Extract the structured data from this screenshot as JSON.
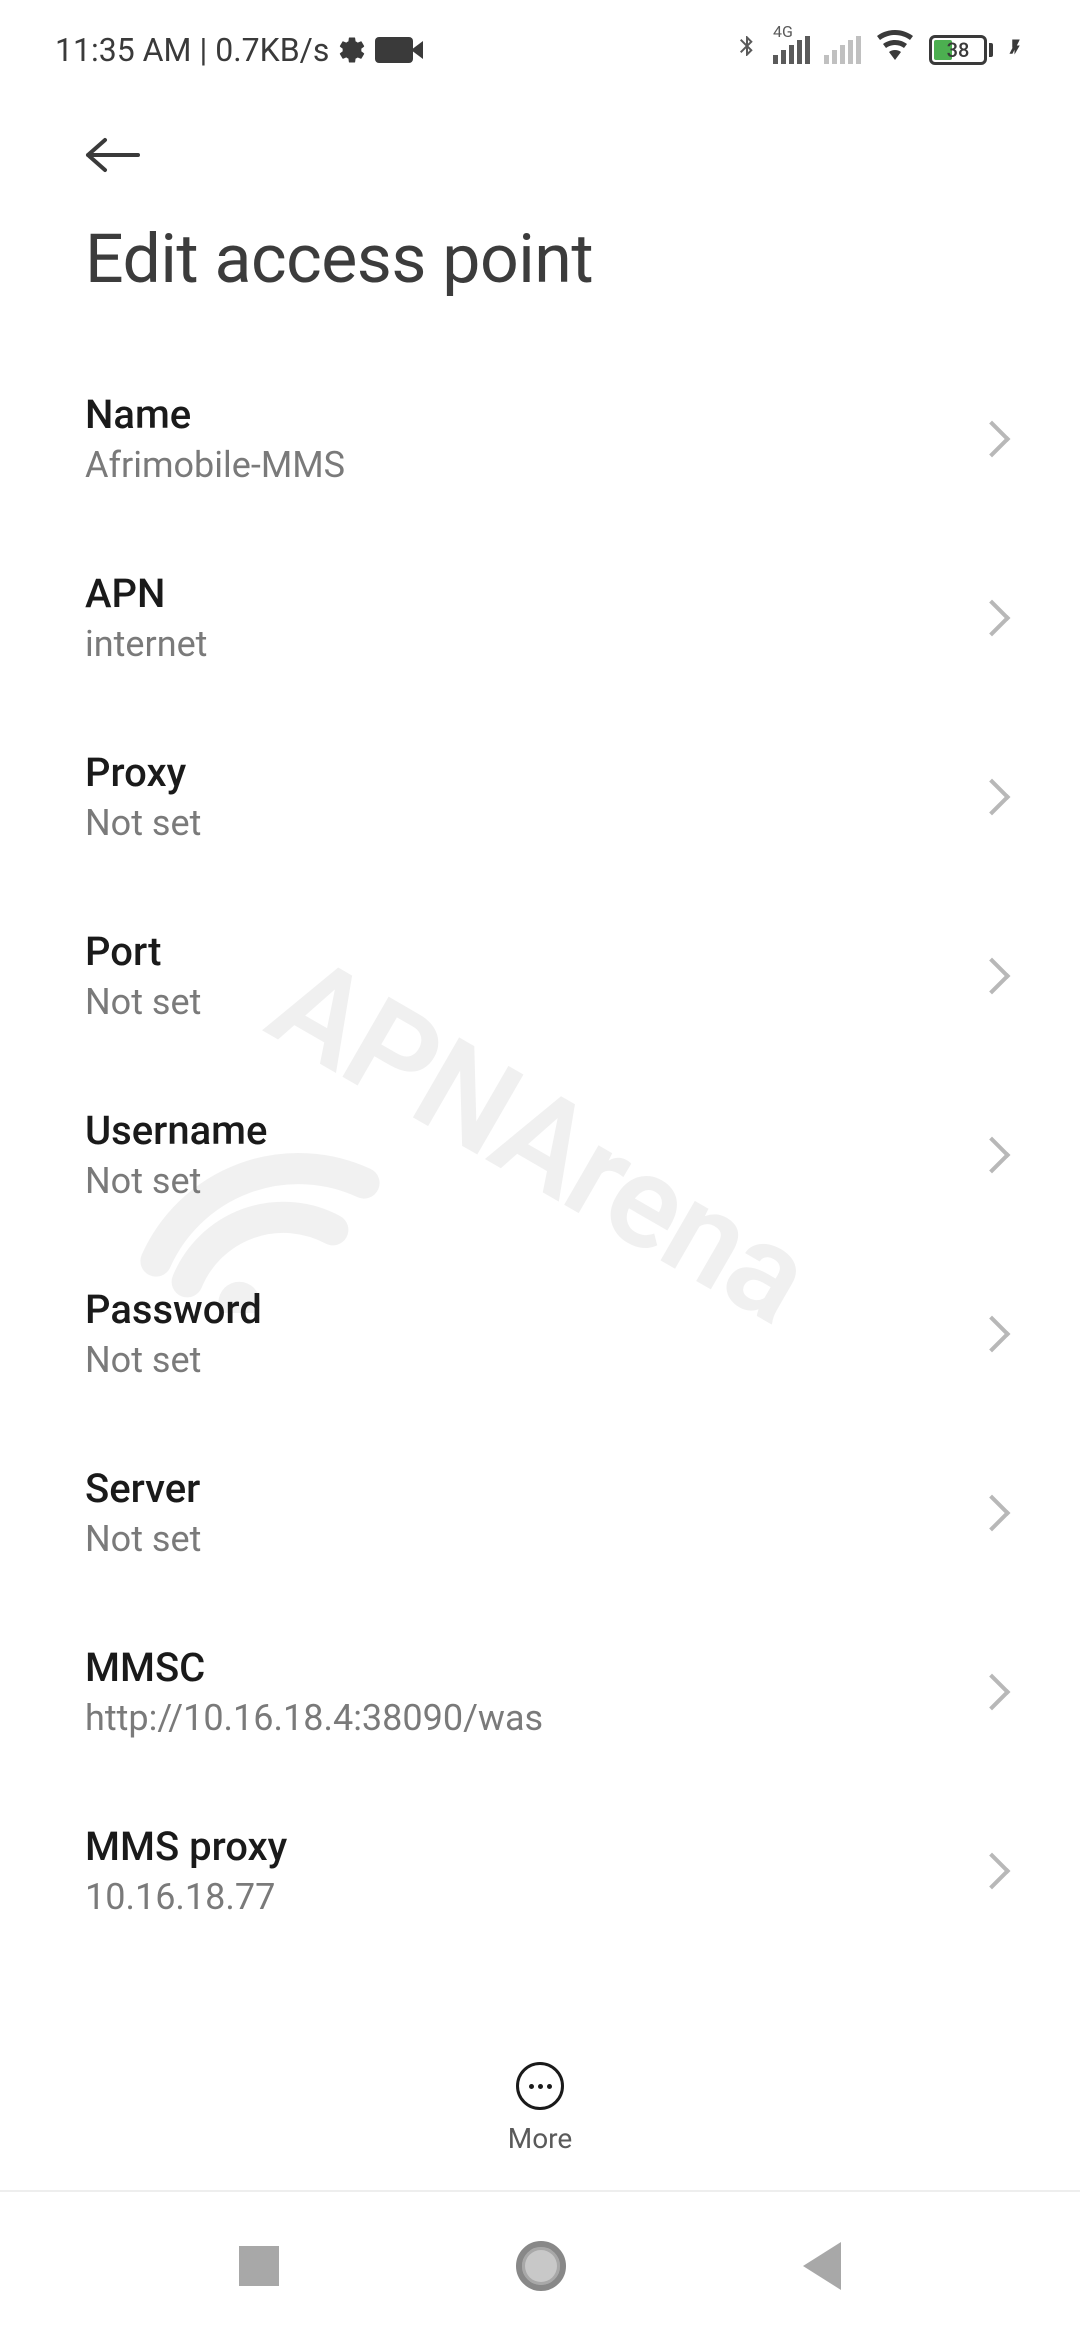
{
  "status": {
    "time": "11:35 AM",
    "speed": "0.7KB/s",
    "network_badge": "4G",
    "battery_pct": "38"
  },
  "header": {
    "title": "Edit access point"
  },
  "settings": [
    {
      "title": "Name",
      "value": "Afrimobile-MMS"
    },
    {
      "title": "APN",
      "value": "internet"
    },
    {
      "title": "Proxy",
      "value": "Not set"
    },
    {
      "title": "Port",
      "value": "Not set"
    },
    {
      "title": "Username",
      "value": "Not set"
    },
    {
      "title": "Password",
      "value": "Not set"
    },
    {
      "title": "Server",
      "value": "Not set"
    },
    {
      "title": "MMSC",
      "value": "http://10.16.18.4:38090/was"
    },
    {
      "title": "MMS proxy",
      "value": "10.16.18.77"
    }
  ],
  "actions": {
    "more_label": "More"
  },
  "watermark": "APNArena"
}
